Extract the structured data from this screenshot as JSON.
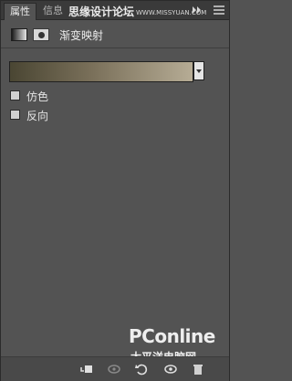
{
  "tabs": [
    {
      "label": "属性",
      "active": true
    },
    {
      "label": "信息",
      "active": false
    }
  ],
  "watermark": {
    "text": "思缘设计论坛",
    "url": "WWW.MISSYUAN.COM"
  },
  "adjustment": {
    "title": "渐变映射"
  },
  "gradient": {
    "colors": [
      "#4a4633",
      "#7a705a",
      "#b6ac95"
    ]
  },
  "options": [
    {
      "label": "仿色",
      "checked": false
    },
    {
      "label": "反向",
      "checked": false
    }
  ],
  "logo": {
    "text": "PConline",
    "sub": "太平洋电脑网"
  },
  "toolbar": {
    "icons": [
      "clip-to-layer-icon",
      "view-previous-state-icon",
      "reset-icon",
      "visibility-icon",
      "delete-icon"
    ]
  }
}
